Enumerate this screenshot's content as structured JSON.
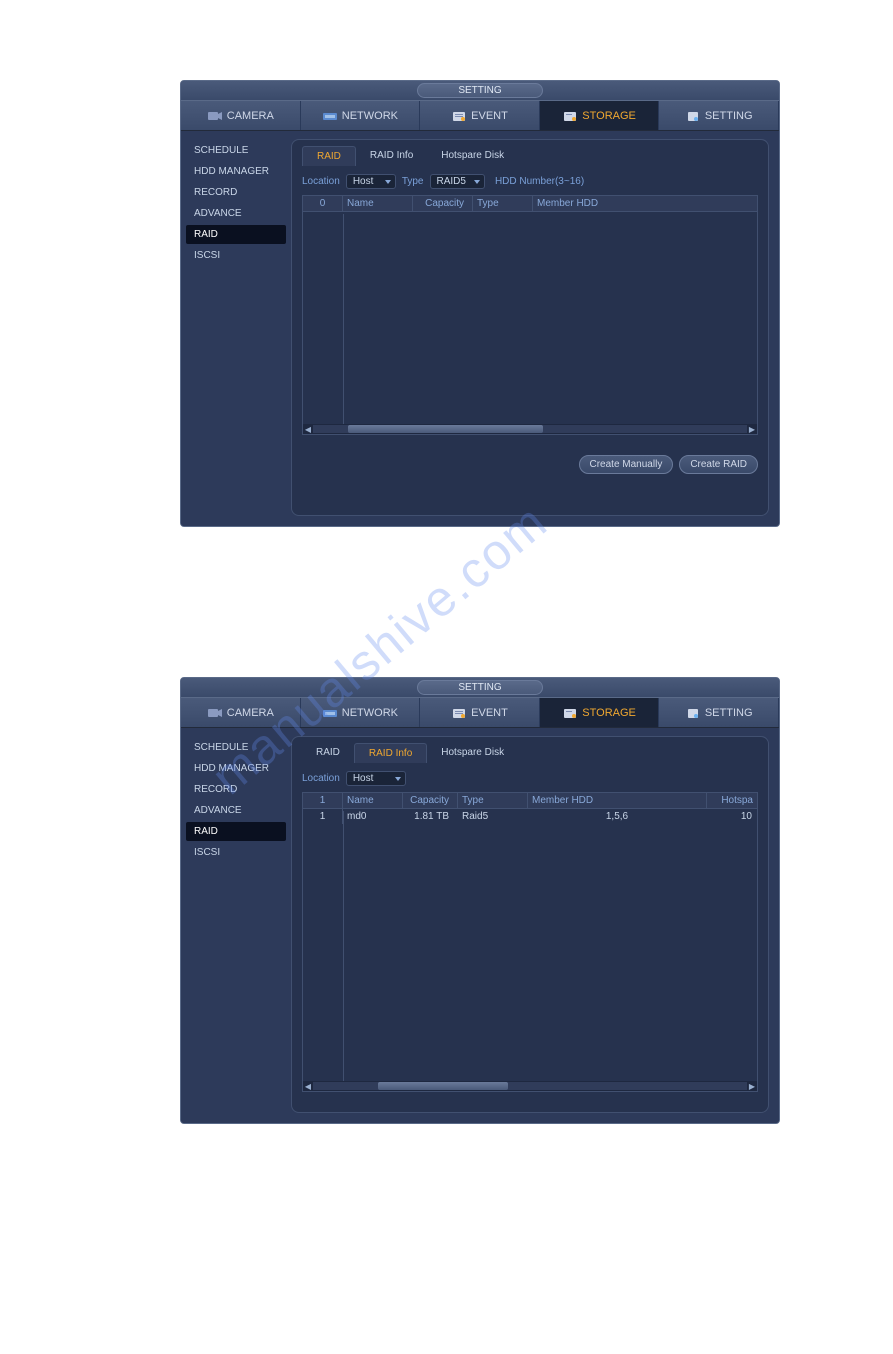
{
  "title": "SETTING",
  "mainTabs": {
    "camera": "CAMERA",
    "network": "NETWORK",
    "event": "EVENT",
    "storage": "STORAGE",
    "setting": "SETTING"
  },
  "sidebar": {
    "items": [
      "SCHEDULE",
      "HDD MANAGER",
      "RECORD",
      "ADVANCE",
      "RAID",
      "ISCSI"
    ]
  },
  "window1": {
    "subTabs": {
      "raid": "RAID",
      "raidInfo": "RAID Info",
      "hotspare": "Hotspare Disk"
    },
    "filters": {
      "locationLabel": "Location",
      "locationValue": "Host",
      "typeLabel": "Type",
      "typeValue": "RAID5",
      "hddNumber": "HDD Number(3~16)"
    },
    "tableHeaders": {
      "idx": "0",
      "name": "Name",
      "capacity": "Capacity",
      "type": "Type",
      "member": "Member HDD"
    },
    "buttons": {
      "createManually": "Create Manually",
      "createRaid": "Create RAID"
    }
  },
  "window2": {
    "subTabs": {
      "raid": "RAID",
      "raidInfo": "RAID Info",
      "hotspare": "Hotspare Disk"
    },
    "filters": {
      "locationLabel": "Location",
      "locationValue": "Host"
    },
    "tableHeaders": {
      "idx": "1",
      "name": "Name",
      "capacity": "Capacity",
      "type": "Type",
      "member": "Member HDD",
      "hotspare": "Hotspa"
    },
    "rows": [
      {
        "idx": "1",
        "name": "md0",
        "capacity": "1.81 TB",
        "type": "Raid5",
        "member": "1,5,6",
        "hotspare": "10"
      }
    ]
  }
}
